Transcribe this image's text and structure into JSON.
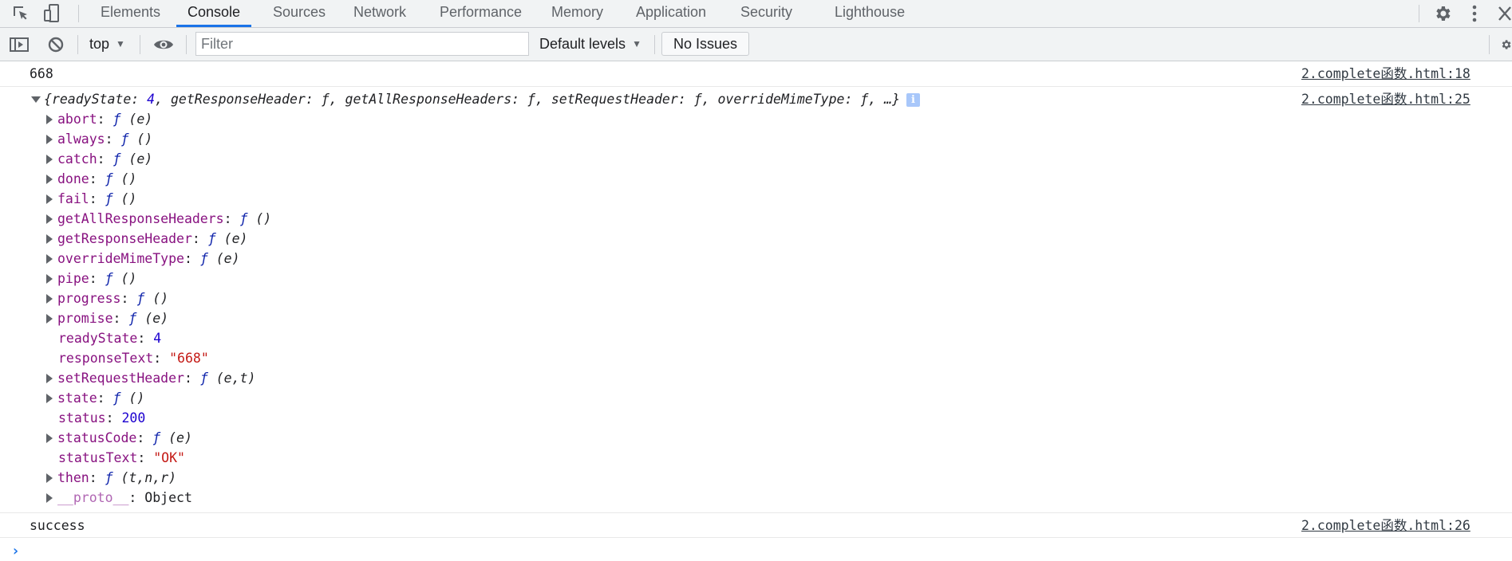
{
  "tabs": [
    {
      "label": "Elements"
    },
    {
      "label": "Console"
    },
    {
      "label": "Sources"
    },
    {
      "label": "Network"
    },
    {
      "label": "Performance"
    },
    {
      "label": "Memory"
    },
    {
      "label": "Application"
    },
    {
      "label": "Security"
    },
    {
      "label": "Lighthouse"
    }
  ],
  "toolbar": {
    "context": "top",
    "filter_placeholder": "Filter",
    "filter_value": "",
    "levels": "Default levels",
    "issues": "No Issues"
  },
  "messages": {
    "m1": {
      "text": "668",
      "source": "2.complete函数.html:18"
    },
    "m2": {
      "source": "2.complete函数.html:25",
      "summary": {
        "open": "{",
        "k1": "readyState",
        "v1": "4",
        "k2": "getResponseHeader",
        "k3": "getAllResponseHeaders",
        "k4": "setRequestHeader",
        "k5": "overrideMimeType",
        "f": "ƒ",
        "close": "…}"
      },
      "props": [
        {
          "key": "abort",
          "fn": "ƒ",
          "args": "(e)"
        },
        {
          "key": "always",
          "fn": "ƒ",
          "args": "()"
        },
        {
          "key": "catch",
          "fn": "ƒ",
          "args": "(e)"
        },
        {
          "key": "done",
          "fn": "ƒ",
          "args": "()"
        },
        {
          "key": "fail",
          "fn": "ƒ",
          "args": "()"
        },
        {
          "key": "getAllResponseHeaders",
          "fn": "ƒ",
          "args": "()"
        },
        {
          "key": "getResponseHeader",
          "fn": "ƒ",
          "args": "(e)"
        },
        {
          "key": "overrideMimeType",
          "fn": "ƒ",
          "args": "(e)"
        },
        {
          "key": "pipe",
          "fn": "ƒ",
          "args": "()"
        },
        {
          "key": "progress",
          "fn": "ƒ",
          "args": "()"
        },
        {
          "key": "promise",
          "fn": "ƒ",
          "args": "(e)"
        },
        {
          "key": "readyState",
          "value": "4"
        },
        {
          "key": "responseText",
          "value": "\"668\""
        },
        {
          "key": "setRequestHeader",
          "fn": "ƒ",
          "args": "(e,t)"
        },
        {
          "key": "state",
          "fn": "ƒ",
          "args": "()"
        },
        {
          "key": "status",
          "value": "200"
        },
        {
          "key": "statusCode",
          "fn": "ƒ",
          "args": "(e)"
        },
        {
          "key": "statusText",
          "value": "\"OK\""
        },
        {
          "key": "then",
          "fn": "ƒ",
          "args": "(t,n,r)"
        },
        {
          "key": "__proto__",
          "value": "Object"
        }
      ]
    },
    "m3": {
      "text": "success",
      "source": "2.complete函数.html:26"
    }
  },
  "prompt": "›",
  "icons": {
    "inspect": "inspect-element-icon",
    "device": "device-toolbar-icon",
    "settings": "gear-icon",
    "more": "kebab-menu-icon",
    "close": "close-icon",
    "sidebar": "sidebar-toggle-icon",
    "clear": "clear-console-icon",
    "eye": "live-expression-eye-icon",
    "info": "info-icon"
  },
  "colors": {
    "accent": "#1a73e8",
    "key": "#881280",
    "function": "#0d22aa",
    "number": "#1c00cf",
    "string": "#c41a16"
  }
}
